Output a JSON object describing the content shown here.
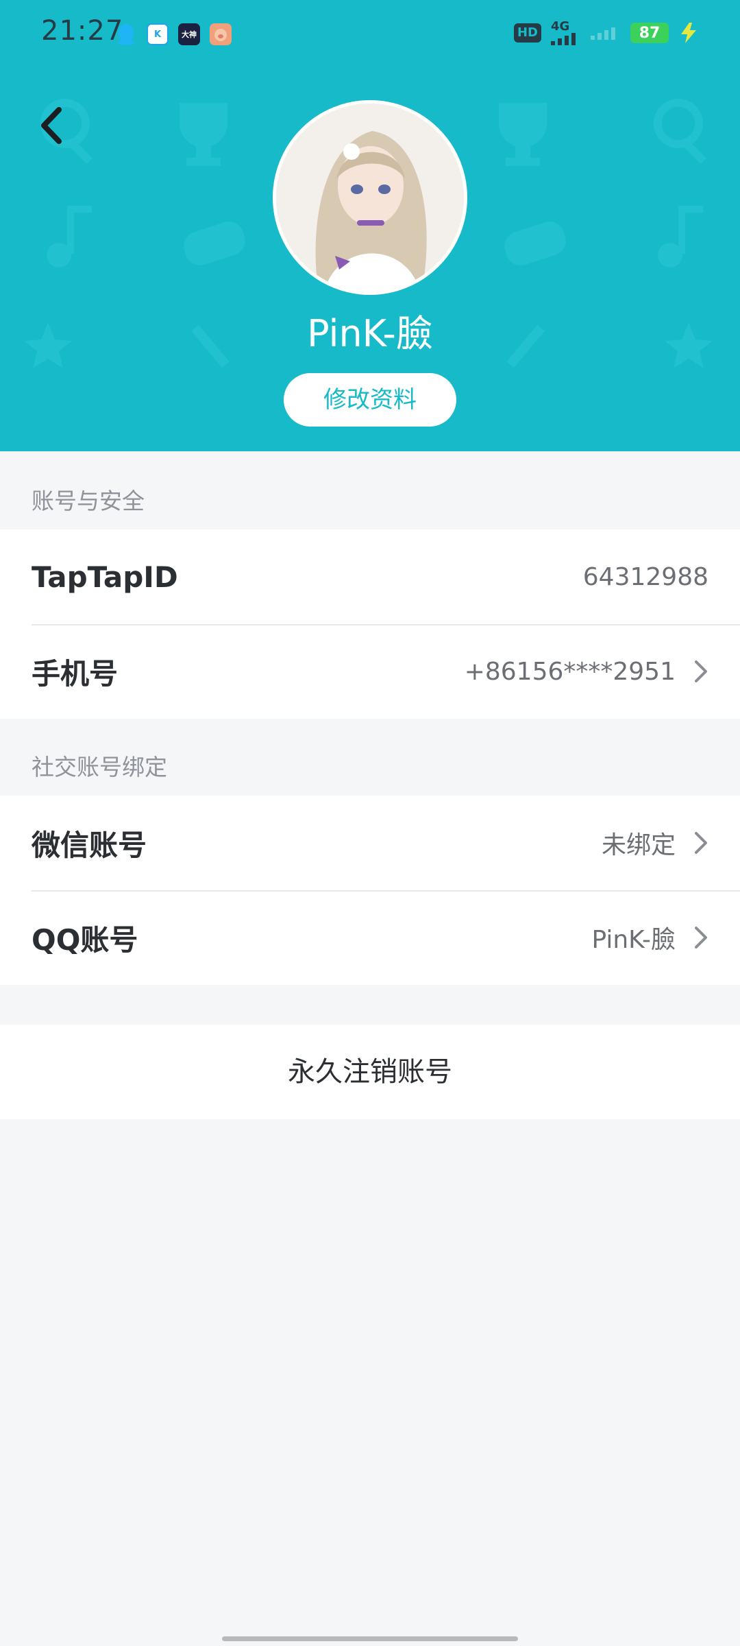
{
  "status_bar": {
    "time": "21:27",
    "hd_label": "HD",
    "network_label": "4G",
    "battery": "87"
  },
  "header": {
    "username": "PinK-臉",
    "edit_profile_label": "修改资料",
    "accent_color": "#16bac9"
  },
  "account_security": {
    "title": "账号与安全",
    "rows": [
      {
        "label": "TapTapID",
        "value": "64312988"
      },
      {
        "label": "手机号",
        "value": "+86156****2951"
      }
    ]
  },
  "social_binding": {
    "title": "社交账号绑定",
    "rows": [
      {
        "label": "微信账号",
        "value": "未绑定"
      },
      {
        "label": "QQ账号",
        "value": "PinK-臉"
      }
    ]
  },
  "delete_account_label": "永久注销账号"
}
